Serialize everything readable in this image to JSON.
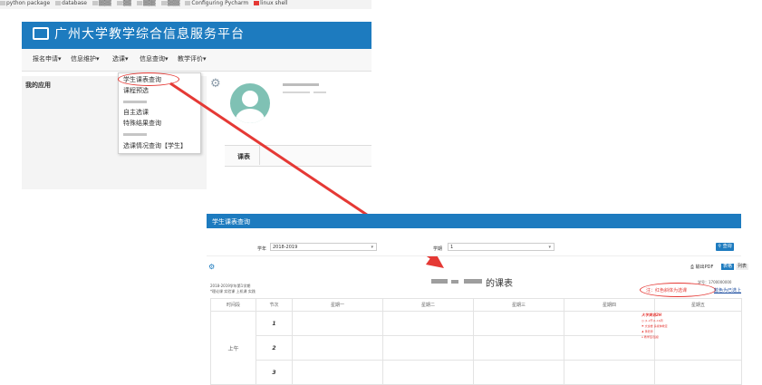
{
  "top": {
    "bookmarks": [
      "python package",
      "database",
      "",
      "",
      "",
      "",
      "Configuring Pycharm",
      "linux shell"
    ],
    "portal_title": "广州大学教学综合信息服务平台",
    "nav": [
      "报名申请▾",
      "信息维护▾",
      "选课▾",
      "信息查询▾",
      "教学评价▾"
    ],
    "left_title": "我的应用",
    "dropdown_items": [
      "学生课表查询",
      "课程预选",
      "",
      "自主选课",
      "特殊结果查询",
      "",
      "选课情况查询【学生】"
    ],
    "tab_label": "课表"
  },
  "bottom": {
    "header_title": "学生课表查询",
    "filter": {
      "year_label": "学年",
      "year_value": "2018-2019",
      "term_label": "学期",
      "term_value": "1",
      "query_label": "查询"
    },
    "pdf_label": "输出PDF",
    "view_list": "列表",
    "view_table": "表格",
    "info_line1": "2018-2019学年第1学期",
    "info_line2": "*理论课 实验课 上机课 实践",
    "info_right": "学号：1700000000",
    "schedule_title_suffix": "的课表",
    "red_note": "注：红色斜体为选课",
    "blue_note": "蓝色为已选上",
    "columns": [
      "时间段",
      "节次",
      "星期一",
      "星期二",
      "星期三",
      "星期四",
      "星期五"
    ],
    "periods": [
      "1",
      "2",
      "3"
    ],
    "time_block": "上午",
    "course": {
      "name": "大学英语2H",
      "lines": [
        "(1-2节)1-16周",
        "文逸楼 多媒体教室",
        "黄老师",
        "教学班/班级"
      ]
    }
  },
  "colors": {
    "brand": "#1d7bbf",
    "annotation": "#e53935"
  }
}
